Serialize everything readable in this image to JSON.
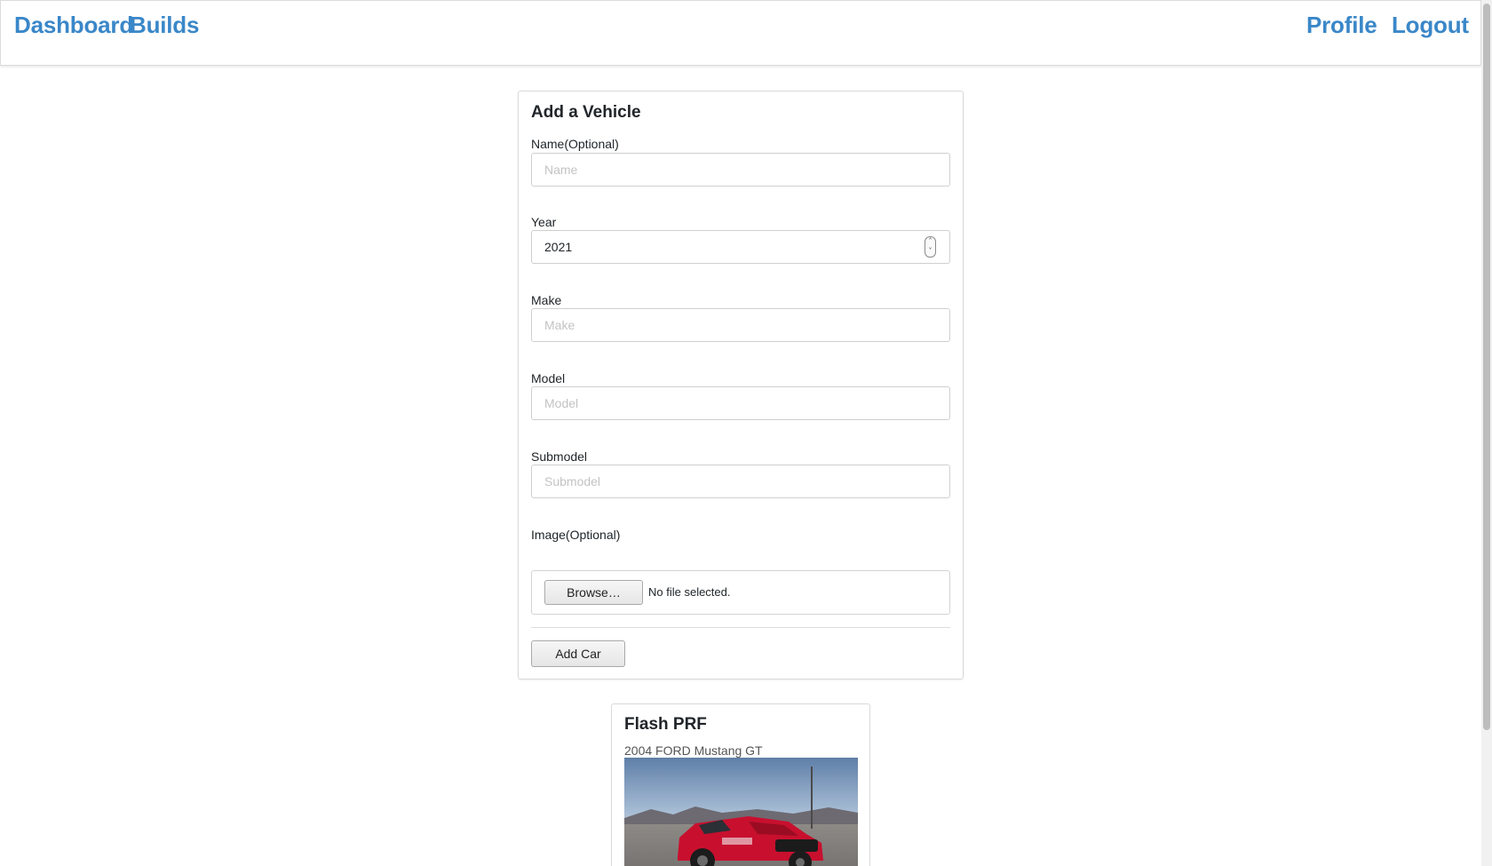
{
  "nav": {
    "dashboard": "Dashboard",
    "builds": "Builds",
    "profile": "Profile",
    "logout": "Logout"
  },
  "form": {
    "title": "Add a Vehicle",
    "name_label": "Name(Optional)",
    "name_placeholder": "Name",
    "year_label": "Year",
    "year_value": "2021",
    "make_label": "Make",
    "make_placeholder": "Make",
    "model_label": "Model",
    "model_placeholder": "Model",
    "submodel_label": "Submodel",
    "submodel_placeholder": "Submodel",
    "image_label": "Image(Optional)",
    "browse_label": "Browse…",
    "file_status": "No file selected.",
    "submit_label": "Add Car"
  },
  "vehicles": [
    {
      "name": "Flash PRF",
      "description": "2004 FORD Mustang GT",
      "color": "#c8102e"
    }
  ],
  "colors": {
    "accent": "#3a87c8"
  }
}
